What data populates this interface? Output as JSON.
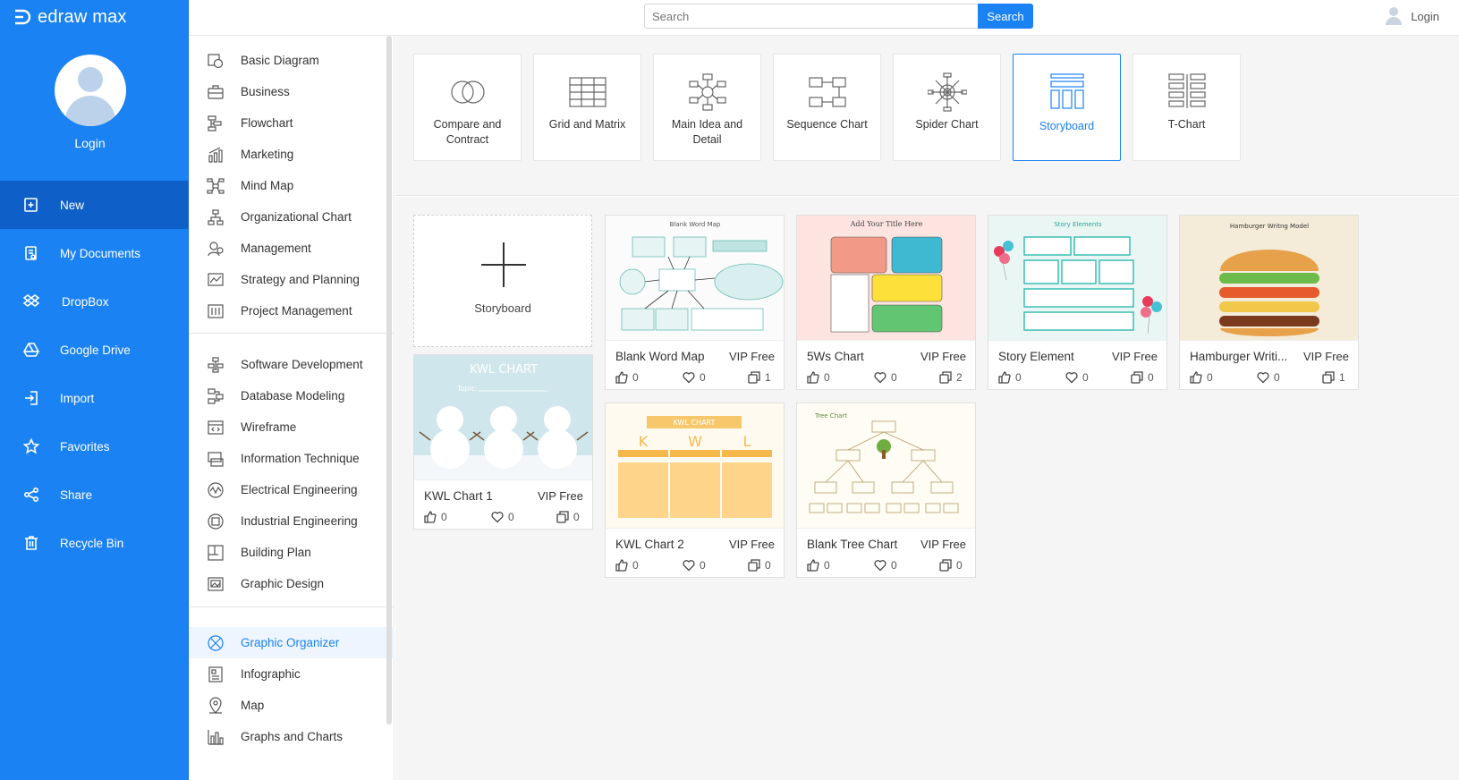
{
  "app": {
    "logo_text": "edraw max"
  },
  "left_sidebar": {
    "login_label": "Login",
    "items": [
      {
        "label": "New",
        "icon": "new-doc-icon"
      },
      {
        "label": "My Documents",
        "icon": "documents-icon"
      },
      {
        "label": "DropBox",
        "icon": "dropbox-icon"
      },
      {
        "label": "Google Drive",
        "icon": "google-drive-icon"
      },
      {
        "label": "Import",
        "icon": "import-icon"
      },
      {
        "label": "Favorites",
        "icon": "star-icon"
      },
      {
        "label": "Share",
        "icon": "share-icon"
      },
      {
        "label": "Recycle Bin",
        "icon": "trash-icon"
      }
    ]
  },
  "topbar": {
    "search_placeholder": "Search",
    "search_button": "Search",
    "login_label": "Login"
  },
  "categories": {
    "group1": [
      "Basic Diagram",
      "Business",
      "Flowchart",
      "Marketing",
      "Mind Map",
      "Organizational Chart",
      "Management",
      "Strategy and Planning",
      "Project Management"
    ],
    "group2": [
      "Software Development",
      "Database Modeling",
      "Wireframe",
      "Information Technique",
      "Electrical Engineering",
      "Industrial Engineering",
      "Building Plan",
      "Graphic Design"
    ],
    "group3": [
      "Graphic Organizer",
      "Infographic",
      "Map",
      "Graphs and Charts"
    ]
  },
  "subcategories": [
    {
      "label": "Compare and Contract"
    },
    {
      "label": "Grid and Matrix"
    },
    {
      "label": "Main Idea and Detail"
    },
    {
      "label": "Sequence Chart"
    },
    {
      "label": "Spider Chart"
    },
    {
      "label": "Storyboard"
    },
    {
      "label": "T-Chart"
    }
  ],
  "new_card": {
    "label": "Storyboard"
  },
  "templates": [
    {
      "name": "KWL Chart 1",
      "badge": "VIP Free",
      "likes": "0",
      "favorites": "0",
      "copies": "0",
      "preview_title": "KWL CHART",
      "preview_sub": "Topic:"
    },
    {
      "name": "Blank Word Map",
      "badge": "VIP Free",
      "likes": "0",
      "favorites": "0",
      "copies": "1",
      "preview_title": "Blank Word Map"
    },
    {
      "name": "KWL Chart 2",
      "badge": "VIP Free",
      "likes": "0",
      "favorites": "0",
      "copies": "0",
      "preview_title": "KWL CHART",
      "preview_letters": [
        "K",
        "W",
        "L"
      ]
    },
    {
      "name": "5Ws Chart",
      "badge": "VIP Free",
      "likes": "0",
      "favorites": "0",
      "copies": "2",
      "preview_title": "Add Your Title Here"
    },
    {
      "name": "Blank Tree Chart",
      "badge": "VIP Free",
      "likes": "0",
      "favorites": "0",
      "copies": "0",
      "preview_title": "Tree Chart"
    },
    {
      "name": "Story Element",
      "badge": "VIP Free",
      "likes": "0",
      "favorites": "0",
      "copies": "0",
      "preview_title": "Story Elements"
    },
    {
      "name": "Hamburger Writi...",
      "badge": "VIP Free",
      "likes": "0",
      "favorites": "0",
      "copies": "1",
      "preview_title": "Hamburger Writng Model"
    }
  ],
  "colors": {
    "accent": "#1a82f2",
    "sidebar": "#1a82f2",
    "sidebar_active": "#0e5fc7"
  }
}
